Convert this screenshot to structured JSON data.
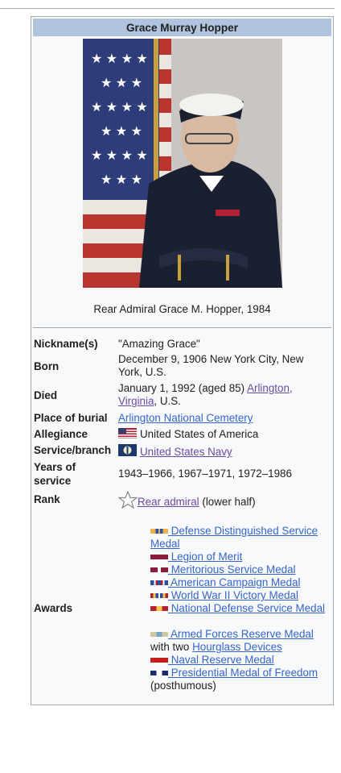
{
  "infobox": {
    "title": "Grace Murray Hopper",
    "caption": "Rear Admiral Grace M. Hopper, 1984",
    "nickname": {
      "label": "Nickname(s)",
      "value": "\"Amazing Grace\""
    },
    "born": {
      "label": "Born",
      "value": "December 9, 1906 New York City, New York, U.S."
    },
    "died": {
      "label": "Died",
      "value_text": "January 1, 1992 (aged 85) ",
      "place_link": "Arlington, Virginia",
      "value_suffix": ", U.S."
    },
    "burial": {
      "label": "Place of burial",
      "link": "Arlington National Cemetery"
    },
    "allegiance": {
      "label": "Allegiance",
      "value": "United States of America"
    },
    "service": {
      "label": "Service/branch",
      "link": "United States Navy"
    },
    "years": {
      "label": "Years of service",
      "value": "1943–1966, 1967–1971, 1972–1986"
    },
    "rank": {
      "label": "Rank",
      "link": "Rear admiral",
      "suffix": " (lower half)"
    },
    "awards": {
      "label": "Awards",
      "items": [
        {
          "text": " Defense Distinguished Service Medal",
          "colors": [
            "#e8b34a",
            "#2a52a8",
            "#e8b34a"
          ]
        },
        {
          "text": " Legion of Merit",
          "colors": [
            "#8a1d3c",
            "#8a1d3c",
            "#8a1d3c"
          ]
        },
        {
          "text": " Meritorious Service Medal",
          "colors": [
            "#8a1d3c",
            "#ffffff",
            "#8a1d3c"
          ]
        },
        {
          "text": " American Campaign Medal",
          "colors": [
            "#2b4fa0",
            "#ffffff",
            "#b22234"
          ]
        },
        {
          "text": " World War II Victory Medal",
          "colors": [
            "#b22234",
            "#f2c94c",
            "#2b4fa0"
          ]
        },
        {
          "text": " National Defense Service Medal",
          "colors": [
            "#b22234",
            "#f2c94c",
            "#b22234"
          ]
        },
        {
          "text": " Armed Forces Reserve Medal",
          "colors": [
            "#cfc8a5",
            "#7aa3c9",
            "#cfc8a5"
          ]
        },
        {
          "text": " Naval Reserve Medal",
          "colors": [
            "#c41e1e",
            "#c41e1e",
            "#c41e1e"
          ]
        },
        {
          "text": " Presidential Medal of Freedom",
          "colors": [
            "#1d2a6b",
            "#ffffff",
            "#1d2a6b"
          ]
        }
      ],
      "with_two": "with two ",
      "hourglass_link": "Hourglass Devices",
      "posthumous": "(posthumous)"
    }
  }
}
